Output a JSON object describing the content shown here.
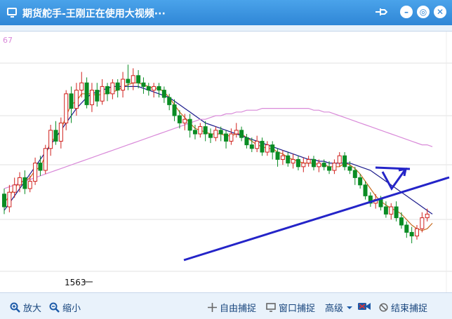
{
  "window": {
    "title": "期货舵手-王刚正在使用大视频···"
  },
  "chart_data": {
    "type": "candlestick",
    "axis_label_top": "67",
    "low_label": "1563",
    "candles": [
      {
        "o": 57,
        "c": 50,
        "h": 46,
        "l": 60
      },
      {
        "o": 50,
        "c": 58,
        "h": 47,
        "l": 62
      },
      {
        "o": 58,
        "c": 62,
        "h": 55,
        "l": 66
      },
      {
        "o": 62,
        "c": 66,
        "h": 58,
        "l": 69
      },
      {
        "o": 66,
        "c": 60,
        "h": 57,
        "l": 70
      },
      {
        "o": 60,
        "c": 64,
        "h": 58,
        "l": 67
      },
      {
        "o": 64,
        "c": 74,
        "h": 62,
        "l": 77
      },
      {
        "o": 74,
        "c": 70,
        "h": 67,
        "l": 78
      },
      {
        "o": 70,
        "c": 82,
        "h": 68,
        "l": 84
      },
      {
        "o": 82,
        "c": 92,
        "h": 78,
        "l": 95
      },
      {
        "o": 92,
        "c": 86,
        "h": 84,
        "l": 97
      },
      {
        "o": 86,
        "c": 96,
        "h": 82,
        "l": 99
      },
      {
        "o": 96,
        "c": 112,
        "h": 92,
        "l": 114
      },
      {
        "o": 112,
        "c": 104,
        "h": 96,
        "l": 116
      },
      {
        "o": 104,
        "c": 114,
        "h": 100,
        "l": 118
      },
      {
        "o": 114,
        "c": 118,
        "h": 110,
        "l": 124
      },
      {
        "o": 118,
        "c": 106,
        "h": 104,
        "l": 121
      },
      {
        "o": 106,
        "c": 114,
        "h": 102,
        "l": 118
      },
      {
        "o": 114,
        "c": 108,
        "h": 105,
        "l": 118
      },
      {
        "o": 108,
        "c": 116,
        "h": 106,
        "l": 120
      },
      {
        "o": 116,
        "c": 112,
        "h": 108,
        "l": 118
      },
      {
        "o": 112,
        "c": 118,
        "h": 109,
        "l": 120
      },
      {
        "o": 118,
        "c": 114,
        "h": 110,
        "l": 120
      },
      {
        "o": 114,
        "c": 120,
        "h": 110,
        "l": 124
      },
      {
        "o": 120,
        "c": 118,
        "h": 114,
        "l": 128
      },
      {
        "o": 118,
        "c": 122,
        "h": 114,
        "l": 126
      },
      {
        "o": 122,
        "c": 118,
        "h": 115,
        "l": 125
      },
      {
        "o": 118,
        "c": 116,
        "h": 112,
        "l": 121
      },
      {
        "o": 116,
        "c": 114,
        "h": 111,
        "l": 118
      },
      {
        "o": 114,
        "c": 116,
        "h": 110,
        "l": 118
      },
      {
        "o": 116,
        "c": 114,
        "h": 110,
        "l": 118
      },
      {
        "o": 114,
        "c": 110,
        "h": 107,
        "l": 116
      },
      {
        "o": 110,
        "c": 106,
        "h": 103,
        "l": 112
      },
      {
        "o": 106,
        "c": 100,
        "h": 97,
        "l": 109
      },
      {
        "o": 100,
        "c": 96,
        "h": 93,
        "l": 103
      },
      {
        "o": 96,
        "c": 98,
        "h": 92,
        "l": 101
      },
      {
        "o": 98,
        "c": 92,
        "h": 88,
        "l": 101
      },
      {
        "o": 92,
        "c": 90,
        "h": 87,
        "l": 95
      },
      {
        "o": 90,
        "c": 94,
        "h": 88,
        "l": 96
      },
      {
        "o": 94,
        "c": 90,
        "h": 86,
        "l": 97
      },
      {
        "o": 90,
        "c": 88,
        "h": 85,
        "l": 93
      },
      {
        "o": 88,
        "c": 92,
        "h": 86,
        "l": 94
      },
      {
        "o": 92,
        "c": 90,
        "h": 86,
        "l": 94
      },
      {
        "o": 90,
        "c": 86,
        "h": 82,
        "l": 92
      },
      {
        "o": 86,
        "c": 90,
        "h": 84,
        "l": 93
      },
      {
        "o": 90,
        "c": 92,
        "h": 88,
        "l": 96
      },
      {
        "o": 92,
        "c": 88,
        "h": 86,
        "l": 94
      },
      {
        "o": 88,
        "c": 84,
        "h": 82,
        "l": 90
      },
      {
        "o": 84,
        "c": 82,
        "h": 80,
        "l": 88
      },
      {
        "o": 82,
        "c": 86,
        "h": 80,
        "l": 89
      },
      {
        "o": 86,
        "c": 80,
        "h": 78,
        "l": 88
      },
      {
        "o": 80,
        "c": 84,
        "h": 78,
        "l": 86
      },
      {
        "o": 84,
        "c": 80,
        "h": 76,
        "l": 86
      },
      {
        "o": 80,
        "c": 76,
        "h": 72,
        "l": 82
      },
      {
        "o": 76,
        "c": 78,
        "h": 73,
        "l": 81
      },
      {
        "o": 78,
        "c": 74,
        "h": 72,
        "l": 80
      },
      {
        "o": 74,
        "c": 76,
        "h": 71,
        "l": 79
      },
      {
        "o": 76,
        "c": 72,
        "h": 70,
        "l": 78
      },
      {
        "o": 72,
        "c": 74,
        "h": 69,
        "l": 77
      },
      {
        "o": 74,
        "c": 76,
        "h": 72,
        "l": 78
      },
      {
        "o": 76,
        "c": 72,
        "h": 70,
        "l": 78
      },
      {
        "o": 72,
        "c": 74,
        "h": 69,
        "l": 76
      },
      {
        "o": 74,
        "c": 72,
        "h": 70,
        "l": 76
      },
      {
        "o": 72,
        "c": 70,
        "h": 68,
        "l": 75
      },
      {
        "o": 70,
        "c": 74,
        "h": 68,
        "l": 76
      },
      {
        "o": 74,
        "c": 78,
        "h": 72,
        "l": 80
      },
      {
        "o": 78,
        "c": 72,
        "h": 70,
        "l": 80
      },
      {
        "o": 72,
        "c": 70,
        "h": 68,
        "l": 75
      },
      {
        "o": 70,
        "c": 66,
        "h": 62,
        "l": 72
      },
      {
        "o": 66,
        "c": 62,
        "h": 60,
        "l": 68
      },
      {
        "o": 62,
        "c": 56,
        "h": 54,
        "l": 64
      },
      {
        "o": 56,
        "c": 52,
        "h": 50,
        "l": 58
      },
      {
        "o": 52,
        "c": 54,
        "h": 49,
        "l": 57
      },
      {
        "o": 54,
        "c": 50,
        "h": 48,
        "l": 56
      },
      {
        "o": 50,
        "c": 46,
        "h": 44,
        "l": 53
      },
      {
        "o": 46,
        "c": 50,
        "h": 43,
        "l": 52
      },
      {
        "o": 50,
        "c": 44,
        "h": 42,
        "l": 53
      },
      {
        "o": 44,
        "c": 40,
        "h": 38,
        "l": 47
      },
      {
        "o": 40,
        "c": 36,
        "h": 33,
        "l": 42
      },
      {
        "o": 36,
        "c": 34,
        "h": 30,
        "l": 39
      },
      {
        "o": 34,
        "c": 38,
        "h": 32,
        "l": 40
      },
      {
        "o": 38,
        "c": 44,
        "h": 36,
        "l": 47
      },
      {
        "o": 44,
        "c": 46,
        "h": 42,
        "l": 49
      }
    ],
    "line_series": [
      {
        "name": "",
        "color": "#c86c20",
        "values": [
          52,
          56,
          60,
          64,
          64,
          66,
          70,
          72,
          78,
          86,
          88,
          92,
          100,
          106,
          108,
          112,
          112,
          112,
          111,
          112,
          112,
          113,
          114,
          116,
          117,
          118,
          118,
          117,
          116,
          115,
          115,
          113,
          110,
          106,
          102,
          99,
          96,
          93,
          92,
          91,
          90,
          90,
          90,
          89,
          89,
          90,
          90,
          88,
          86,
          84,
          83,
          82,
          82,
          80,
          79,
          77,
          76,
          75,
          74,
          74,
          74,
          73,
          73,
          72,
          72,
          72,
          74,
          73,
          71,
          68,
          64,
          60,
          56,
          53,
          51,
          49,
          48,
          46,
          43,
          40,
          38,
          37,
          38,
          41
        ]
      },
      {
        "name": "",
        "color": "#1c1c8c",
        "values": [
          48,
          52,
          56,
          60,
          64,
          68,
          72,
          76,
          80,
          84,
          88,
          92,
          96,
          100,
          104,
          107,
          110,
          112,
          113,
          114,
          115,
          116,
          116,
          116,
          116,
          116,
          116,
          115,
          114,
          113,
          112,
          111,
          110,
          108,
          106,
          104,
          102,
          100,
          98,
          96,
          95,
          94,
          93,
          92,
          91,
          90,
          89,
          88,
          87,
          86,
          85,
          84,
          83,
          82,
          81,
          80,
          79,
          78,
          77,
          76,
          76,
          75,
          75,
          74,
          74,
          74,
          74,
          74,
          73,
          72,
          71,
          70,
          68,
          66,
          64,
          62,
          60,
          58,
          56,
          54,
          52,
          50,
          48,
          46
        ]
      },
      {
        "name": "",
        "color": "#d98ad9",
        "values": [
          60,
          61,
          62,
          63,
          64,
          65,
          66,
          67,
          68,
          69,
          70,
          71,
          72,
          73,
          74,
          75,
          76,
          77,
          78,
          79,
          80,
          81,
          82,
          83,
          84,
          85,
          86,
          87,
          88,
          89,
          90,
          91,
          92,
          93,
          94,
          95,
          96,
          97,
          98,
          98,
          99,
          100,
          100,
          101,
          101,
          102,
          102,
          103,
          103,
          103,
          104,
          104,
          104,
          104,
          104,
          104,
          104,
          104,
          104,
          104,
          103,
          103,
          102,
          102,
          101,
          100,
          99,
          98,
          97,
          96,
          95,
          94,
          93,
          92,
          91,
          90,
          89,
          88,
          87,
          86,
          85,
          84,
          84,
          83
        ]
      }
    ]
  },
  "toolbar": {
    "zoom_in": "放大",
    "zoom_out": "缩小",
    "free_capture": "自由捕捉",
    "window_capture": "窗口捕捉",
    "advanced": "高级",
    "end_capture": "结束捕捉"
  }
}
